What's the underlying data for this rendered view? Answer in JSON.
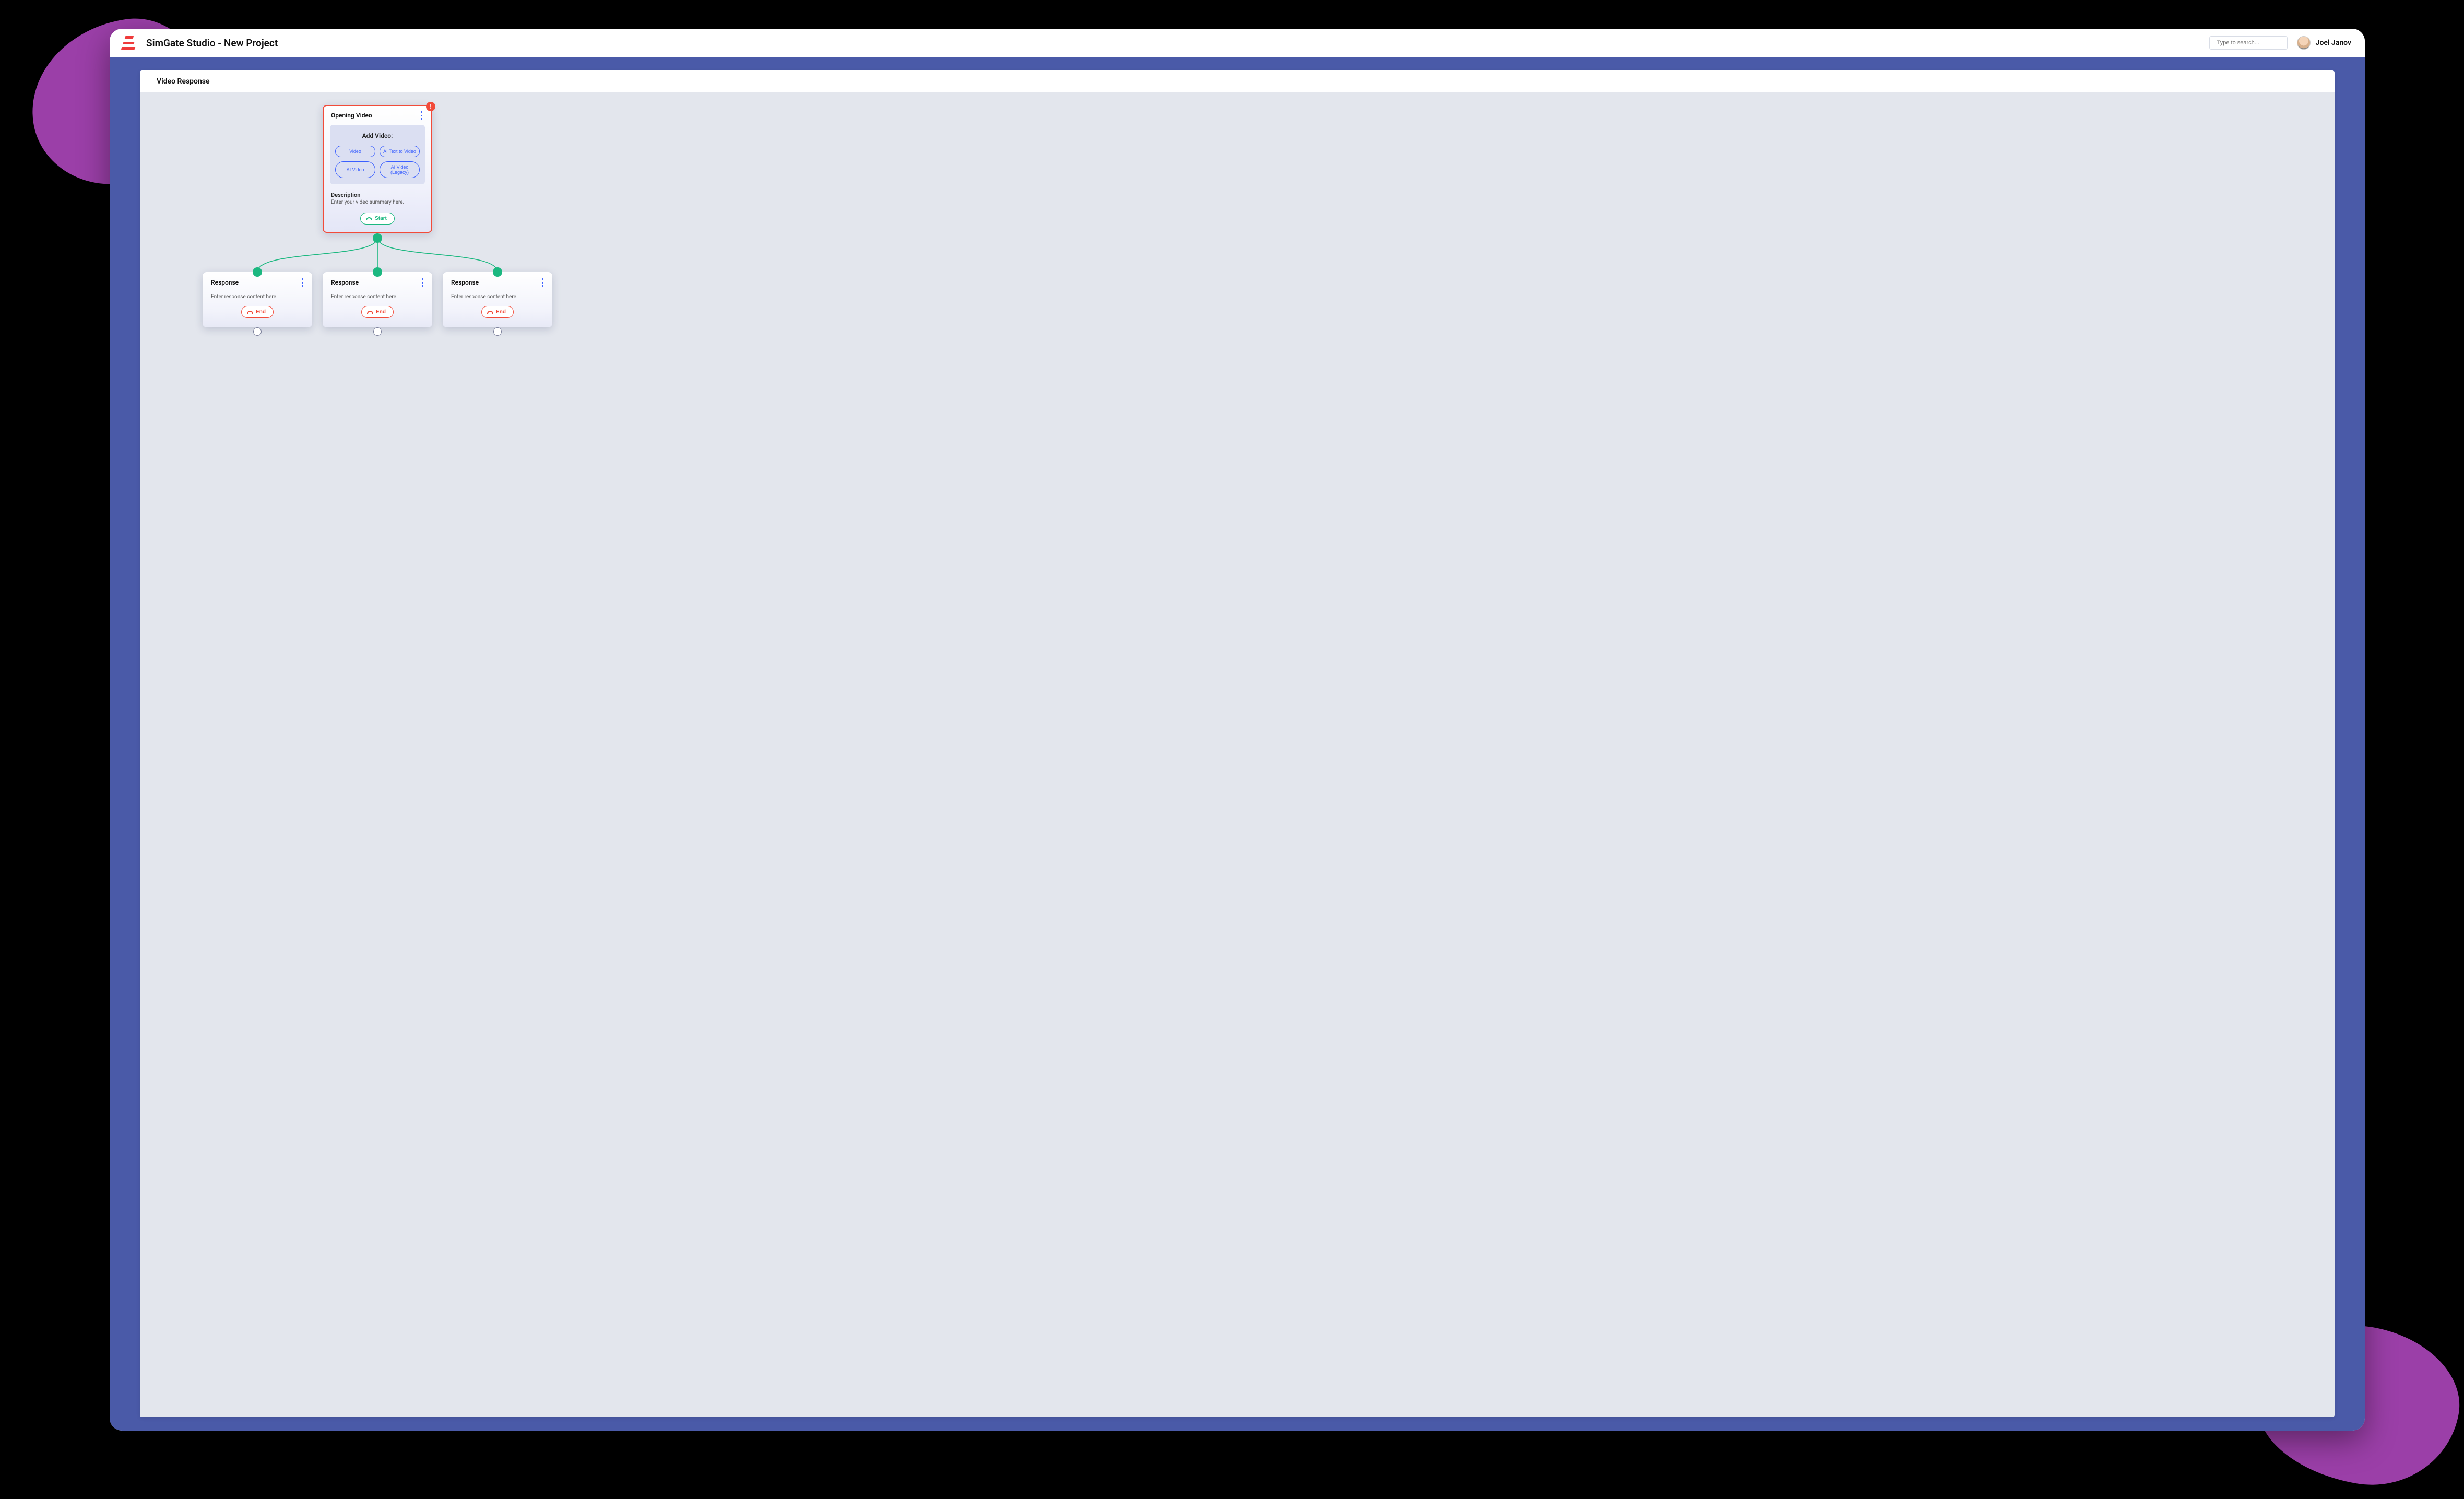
{
  "app": {
    "title": "SimGate Studio - New Project",
    "search_placeholder": "Type to search...",
    "user_name": "Joel Janov"
  },
  "canvas": {
    "title": "Video Response"
  },
  "opening_node": {
    "title": "Opening Video",
    "alert": "!",
    "add_video_label": "Add Video:",
    "buttons": {
      "video": "Video",
      "ai_text_to_video": "AI Text to Video",
      "ai_video": "AI Video",
      "ai_video_legacy": "AI Video (Legacy)"
    },
    "description_label": "Description",
    "description_placeholder": "Enter your video summary here.",
    "start_label": "Start"
  },
  "response_nodes": [
    {
      "title": "Response",
      "placeholder": "Enter response content here.",
      "end_label": "End"
    },
    {
      "title": "Response",
      "placeholder": "Enter response content here.",
      "end_label": "End"
    },
    {
      "title": "Response",
      "placeholder": "Enter response content here.",
      "end_label": "End"
    }
  ],
  "colors": {
    "accent_blue": "#3a5fff",
    "body_blue": "#4a5aa8",
    "alert_red": "#f24b3a",
    "green": "#1cb880",
    "purple_blob": "#9b3fa8"
  }
}
